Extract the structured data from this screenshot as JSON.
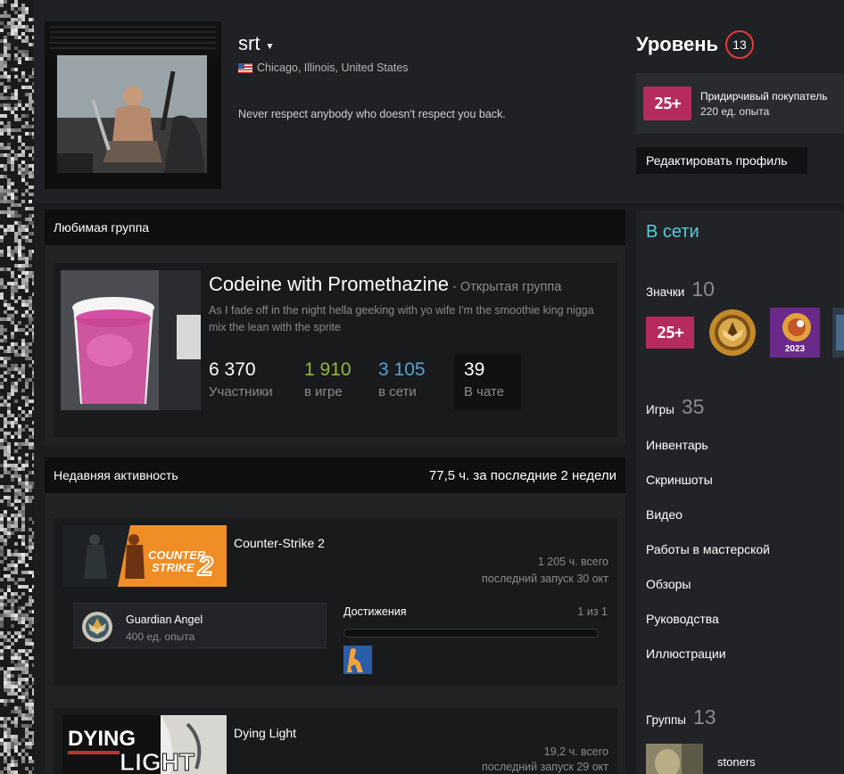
{
  "profile": {
    "persona_name": "srt",
    "location": "Chicago, Illinois, United States",
    "summary": "Never respect anybody who doesn't respect you back."
  },
  "level": {
    "label": "Уровень",
    "value": "13",
    "ring_color": "#e43b3b"
  },
  "favorite_badge": {
    "icon_text": "25+",
    "name": "Придирчивый покупатель",
    "xp": "220 ед. опыта"
  },
  "edit_profile_label": "Редактировать профиль",
  "favorite_group": {
    "header": "Любимая группа",
    "name": "Codeine with Promethazine",
    "type": " - Открытая группа",
    "description": "As I fade off in the night hella geeking with yo wife I'm the smoothie king nigga mix the lean with the sprite",
    "stats": [
      {
        "value": "6 370",
        "label": "Участники",
        "color": "#ffffff"
      },
      {
        "value": "1 910",
        "label": "в игре",
        "color": "#90ba3c"
      },
      {
        "value": "3 105",
        "label": "в сети",
        "color": "#57a0d6"
      }
    ],
    "chat": {
      "value": "39",
      "label": "В чате"
    }
  },
  "recent_activity": {
    "header": "Недавняя активность",
    "summary": "77,5 ч. за последние 2 недели",
    "games": [
      {
        "name": "Counter-Strike 2",
        "hours_total": "1 205 ч. всего",
        "last_played": "последний запуск 30 окт",
        "capsule_text": "COUNTER STRIKE 2",
        "achievement": {
          "name": "Guardian Angel",
          "xp": "400 ед. опыта"
        },
        "achievements_label": "Достижения",
        "achievements_count": "1 из 1"
      },
      {
        "name": "Dying Light",
        "hours_total": "19,2 ч. всего",
        "last_played": "последний запуск 29 окт",
        "capsule_text": "DYING LIGHT"
      }
    ]
  },
  "sidebar": {
    "status": "В сети",
    "badges": {
      "label": "Значки",
      "count": "10",
      "icons": [
        "badge-25plus-icon",
        "badge-cs-emblem-icon",
        "badge-steam-2023-icon",
        "badge-partial-icon"
      ],
      "badge_2023_text": "2023"
    },
    "games": {
      "label": "Игры",
      "count": "35"
    },
    "links": [
      "Инвентарь",
      "Скриншоты",
      "Видео",
      "Работы в мастерской",
      "Обзоры",
      "Руководства",
      "Иллюстрации"
    ],
    "groups": {
      "label": "Группы",
      "count": "13",
      "first": "stoners"
    }
  }
}
